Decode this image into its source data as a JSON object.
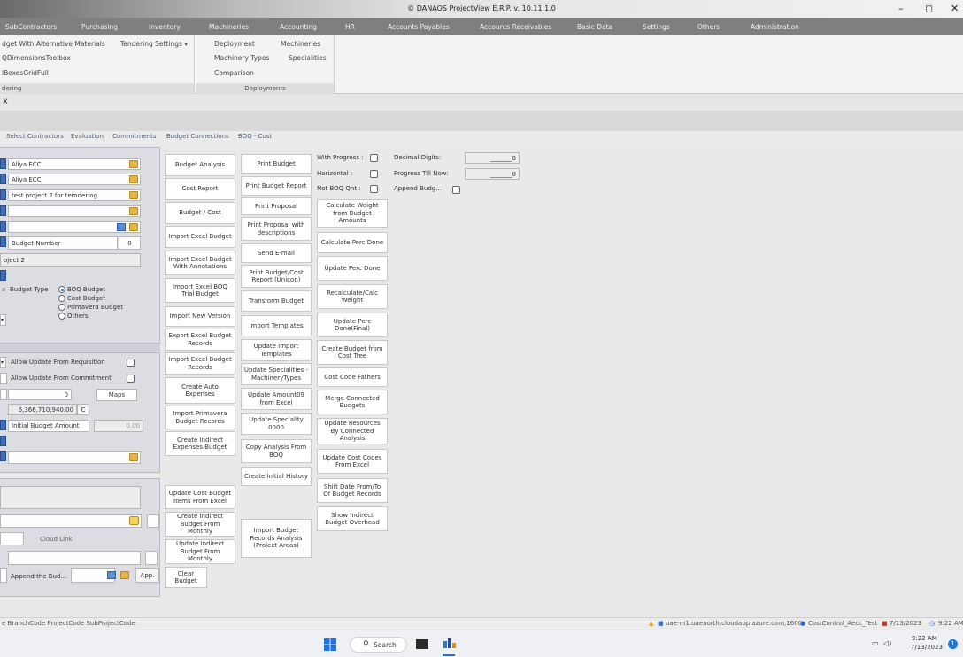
{
  "window": {
    "title": "© DANAOS ProjectView E.R.P. v. 10.11.1.0",
    "minimize": "–",
    "maximize": "◻",
    "close": "✕"
  },
  "menu": [
    "SubContractors",
    "Purchasing",
    "Inventory",
    "Machineries",
    "Accounting",
    "HR",
    "Accounts Payables",
    "Accounts Receivables",
    "Basic Data",
    "Settings",
    "Others",
    "Administration"
  ],
  "ribbon": {
    "group1": {
      "items": [
        "dget With Alternative Materials",
        "QDimensionsToolbox",
        "lBoxesGridFull"
      ],
      "tendering_settings": "Tendering Settings",
      "caption": "dering"
    },
    "group2": {
      "items": [
        "Deployment",
        "Machinery Types",
        "Comparison"
      ],
      "items_right": [
        "Machineries",
        "Specialities"
      ],
      "caption": "Deployments"
    }
  },
  "tab_close": "x",
  "subtabs": [
    "Select Contractors",
    "Evaluation",
    "Commitments",
    "Budget Connections",
    "BOQ - Cost"
  ],
  "left": {
    "f1": "Aliya ECC",
    "f2": "Aliya ECC",
    "f3": "test project 2 for temdering",
    "budget_number_label": "Budget Number",
    "budget_number_value": "0",
    "project_text": "oject 2",
    "budget_type_label": "Budget Type",
    "budget_types": [
      "BOQ Budget",
      "Cost Budget",
      "Primavera Budget",
      "Others"
    ],
    "allow_req": "Allow Update From Requisition",
    "allow_commit": "Allow Update From Commitment",
    "zero_value": "0",
    "maps": "Maps",
    "amount": "6,366,710,940.00",
    "c_btn": "C",
    "initial_budget": "Initial Budget Amount",
    "initial_value": "0.00",
    "cloud_link": "Cloud Link",
    "append": "Append the Bud...",
    "app_btn": "App."
  },
  "buttons_col1": [
    "Budget Analysis",
    "Cost Report",
    "Budget / Cost",
    "Import Excel Budget",
    "Import Excel Budget With Annotations",
    "Import Excel BOQ Trial Budget",
    "Import New Version",
    "Export Excel Budget Records",
    "Import Excel Budget Records",
    "Create Auto Expenses",
    "Import Primavera Budget Records",
    "Create Indirect Expenses Budget",
    "Update Cost Budget Items From Excel",
    "Create Indirect Budget From Monthly",
    "Update Indirect Budget From Monthly",
    "Clear Budget"
  ],
  "buttons_col2": [
    "Print Budget",
    "Print Budget Report",
    "Print Proposal",
    "Print Proposal with descriptions",
    "Send E-mail",
    "Print Budget/Cost Report (Unicon)",
    "Transform Budget",
    "Import Templates",
    "Update Import Templates",
    "Update Specialities - MachineryTypes",
    "Update Amount09 from Excel",
    "Update Speciality 0000",
    "Copy Analysis From BOQ",
    "Create Initial History",
    "Import Budget Records Analysis (Project Areas)"
  ],
  "buttons_col3": [
    "Calculate Weight from Budget Amounts",
    "Calculate Perc Done",
    "Update Perc Done",
    "Recalculate/Calc Weight",
    "Update Perc Done(Final)",
    "Create Budget from Cost Tree",
    "Cost Code Fathers",
    "Merge Connected Budgets",
    "Update Resources By Connected Analysis",
    "Update Cost Codes From Excel",
    "Shift Date From/To Of Budget Records",
    "Show Indirect Budget Overhead"
  ],
  "options": {
    "with_progress": "With Progress :",
    "horizontal": "Horizontal :",
    "not_boq": "Not BOQ Qnt :",
    "decimal_digits": "Decimal Digits:",
    "progress_till": "Progress Till Now:",
    "append_budg": "Append Budg...",
    "decimal_value": "_______0",
    "progress_value": "_______0"
  },
  "status": {
    "left": "e BranchCode  ProjectCode  SubProjectCode",
    "server": "uae-m1.uaenorth.cloudapp.azure.com,1600",
    "db": "CostControl_Aecc_Test",
    "date": "7/13/2023",
    "time": "9:22 AM"
  },
  "taskbar": {
    "search": "Search",
    "time": "9:22 AM",
    "date": "7/13/2023",
    "notif": "1"
  }
}
